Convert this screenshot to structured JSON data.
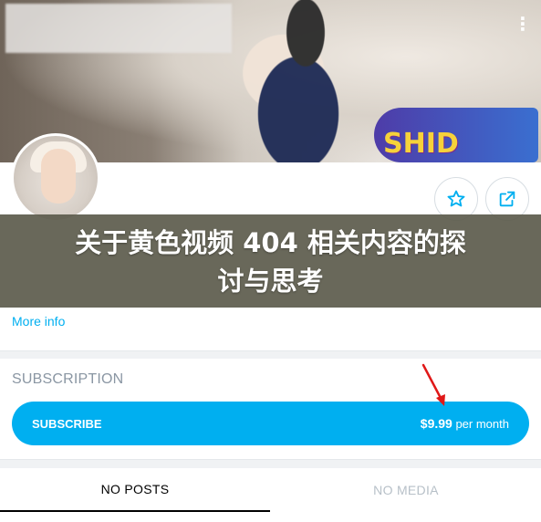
{
  "cover": {
    "sign_text": "SHID"
  },
  "overlay": {
    "title_line1": "关于黄色视频 404 相关内容的探",
    "title_line2": "讨与思考"
  },
  "profile": {
    "more_info": "More info"
  },
  "subscription": {
    "heading": "SUBSCRIPTION",
    "button_label": "SUBSCRIBE",
    "price": "$9.99",
    "period": "per month"
  },
  "tabs": [
    {
      "label": "NO POSTS",
      "active": true
    },
    {
      "label": "NO MEDIA",
      "active": false
    }
  ],
  "icons": {
    "more": "vertical-dots-icon",
    "favorite": "star-icon",
    "share": "share-icon",
    "annotation": "red-arrow-icon"
  },
  "colors": {
    "accent": "#00aff0",
    "overlay": "#5c5b4c",
    "arrow": "#e01818",
    "muted": "#8a96a3",
    "inactive_tab": "#b7c0c8"
  }
}
